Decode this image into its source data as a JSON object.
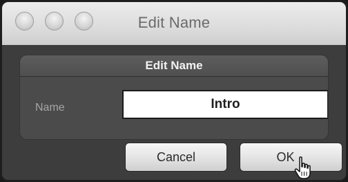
{
  "window": {
    "title": "Edit Name"
  },
  "dialog": {
    "group_title": "Edit Name",
    "name_label": "Name",
    "name_value": "Intro"
  },
  "buttons": {
    "cancel_label": "Cancel",
    "ok_label": "OK"
  },
  "icons": {
    "close": "close-button-icon",
    "minimize": "minimize-button-icon",
    "zoom": "zoom-button-icon",
    "cursor": "hand-pointer-cursor-icon"
  },
  "colors": {
    "titlebar": "#dcdcdc",
    "content_bg": "#3d3d3d",
    "group_bg": "#4b4b4b",
    "input_bg": "#ffffff"
  }
}
